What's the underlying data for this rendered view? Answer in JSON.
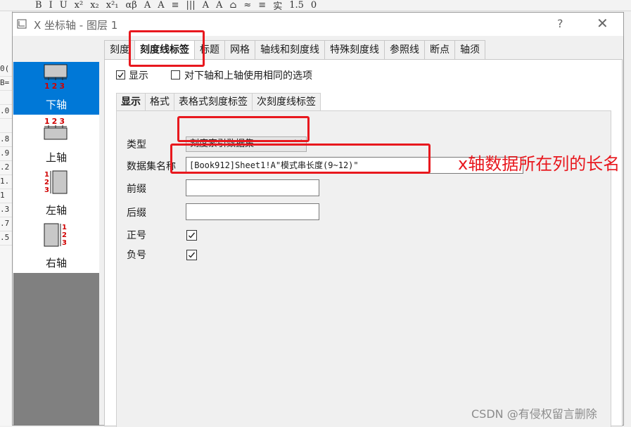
{
  "app_toolbar": {
    "items": [
      "B",
      "I",
      "U",
      "x²",
      "x₂",
      "x²₁",
      "αβ",
      "A",
      "A",
      "≡",
      "|||",
      "A",
      "A",
      "⌂",
      "≈",
      "≡",
      "实",
      "1.5",
      "0"
    ]
  },
  "app_left": {
    "cells": [
      "0(",
      "B=",
      "",
      ".0",
      "",
      ".8",
      ".9",
      ".2",
      "1.",
      "1",
      ".3",
      ".7",
      ".5"
    ]
  },
  "dialog": {
    "title": "X 坐标轴 - 图层 1",
    "help": "?",
    "close": "✕"
  },
  "sidebar": {
    "items": [
      {
        "label": "下轴",
        "selected": true,
        "icon": "bottom-axis-icon",
        "ticks": "123"
      },
      {
        "label": "上轴",
        "selected": false,
        "icon": "top-axis-icon",
        "ticks": "123"
      },
      {
        "label": "左轴",
        "selected": false,
        "icon": "left-axis-icon",
        "ticks": "123"
      },
      {
        "label": "右轴",
        "selected": false,
        "icon": "right-axis-icon",
        "ticks": "123"
      }
    ]
  },
  "tabs": [
    "刻度",
    "刻度线标签",
    "标题",
    "网格",
    "轴线和刻度线",
    "特殊刻度线",
    "参照线",
    "断点",
    "轴须"
  ],
  "active_tab": "刻度线标签",
  "panel": {
    "show_label": "显示",
    "show_checked": true,
    "same_options_label": "对下轴和上轴使用相同的选项",
    "same_options_checked": false,
    "subtabs": [
      "显示",
      "格式",
      "表格式刻度标签",
      "次刻度线标签"
    ],
    "active_subtab": "显示",
    "type_label": "类型",
    "type_value": "刻度索引数据集",
    "dataset_label": "数据集名称",
    "dataset_value": "[Book912]Sheet1!A\"模式串长度(9~12)\"",
    "prefix_label": "前缀",
    "prefix_value": "",
    "suffix_label": "后缀",
    "suffix_value": "",
    "plus_label": "正号",
    "plus_checked": true,
    "minus_label": "负号",
    "minus_checked": true
  },
  "annotation": "x轴数据所在列的长名",
  "watermark": "CSDN @有侵权留言删除",
  "colors": {
    "highlight": "#e8181e",
    "selected": "#0078d7",
    "sidebar_bg": "#808080"
  }
}
